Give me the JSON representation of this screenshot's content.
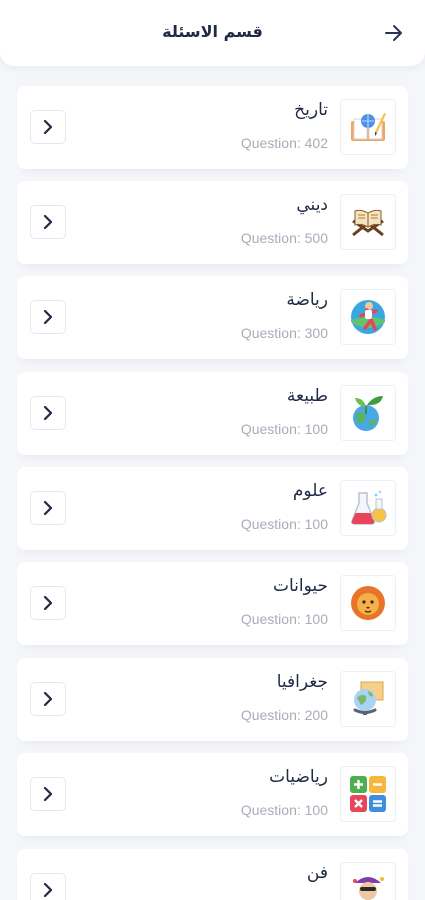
{
  "header": {
    "title": "قسم الاسئلة"
  },
  "categories": [
    {
      "title": "تاريخ",
      "subtitle": "Question: 402",
      "icon": "history-book-icon"
    },
    {
      "title": "ديني",
      "subtitle": "Question: 500",
      "icon": "quran-icon"
    },
    {
      "title": "رياضة",
      "subtitle": "Question: 300",
      "icon": "runner-icon"
    },
    {
      "title": "طبيعة",
      "subtitle": "Question: 100",
      "icon": "earth-plant-icon"
    },
    {
      "title": "علوم",
      "subtitle": "Question: 100",
      "icon": "flask-icon"
    },
    {
      "title": "حيوانات",
      "subtitle": "Question: 100",
      "icon": "lion-icon"
    },
    {
      "title": "جغرافيا",
      "subtitle": "Question: 200",
      "icon": "globe-icon"
    },
    {
      "title": "رياضيات",
      "subtitle": "Question: 100",
      "icon": "calculator-icon"
    },
    {
      "title": "فن",
      "subtitle": "",
      "icon": "artist-icon"
    }
  ]
}
